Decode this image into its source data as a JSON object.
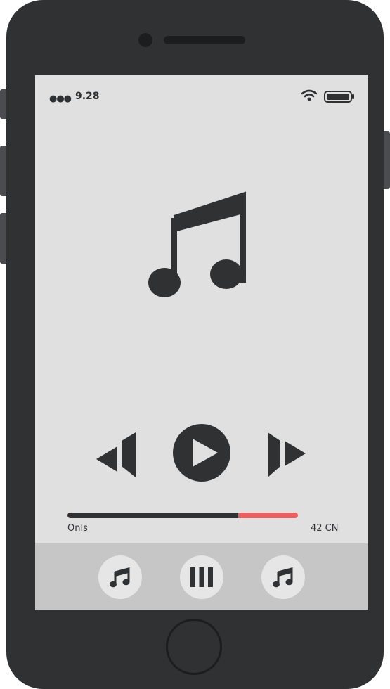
{
  "status_bar": {
    "signal": "●●●",
    "time": "9.28"
  },
  "player": {
    "progress": 0.74,
    "time_left": "Onls",
    "time_right": "42 CN"
  },
  "icons": {
    "artwork": "music-note-icon",
    "prev": "previous-icon",
    "play": "play-icon",
    "next": "next-icon",
    "wifi": "wifi-icon",
    "battery": "battery-icon",
    "tabs": [
      "music-note-icon",
      "library-icon",
      "music-note-icon"
    ]
  },
  "colors": {
    "body": "#2f3133",
    "screen": "#e0e0e1",
    "progress_played": "#2f3133",
    "progress_remaining": "#e86060",
    "tab_bar": "#c6c6c7"
  }
}
